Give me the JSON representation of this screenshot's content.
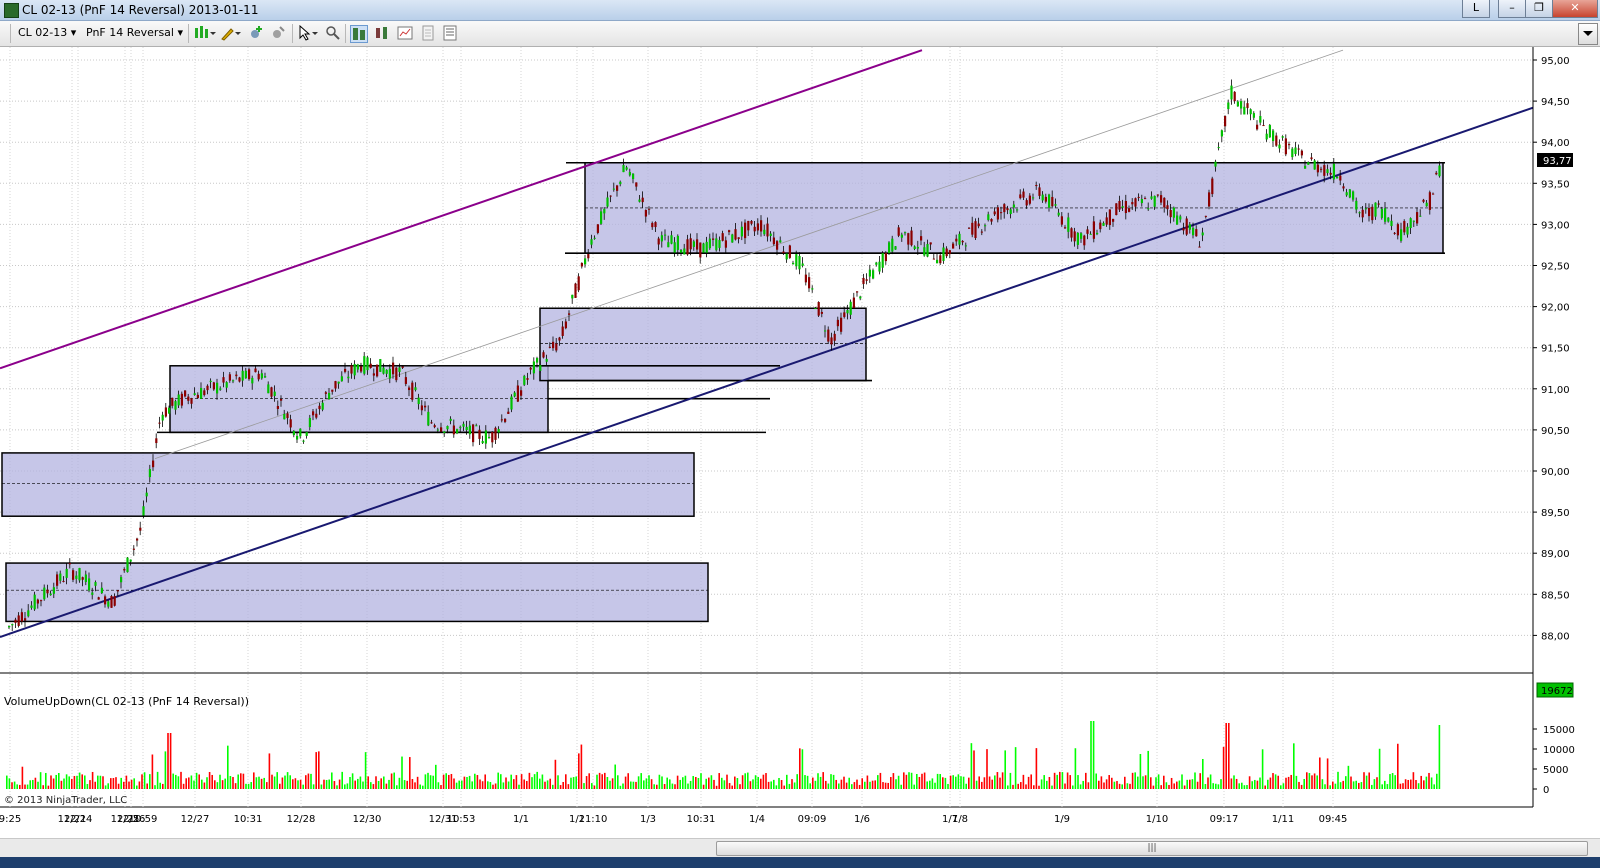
{
  "window": {
    "title": "CL 02-13 (PnF 14 Reversal)  2013-01-11",
    "link_button": "L"
  },
  "toolbar": {
    "instrument": "CL 02-13",
    "period": "PnF 14 Reversal"
  },
  "indicator": {
    "label": "VolumeUpDown(CL 02-13 (PnF 14 Reversal))"
  },
  "copyright": "© 2013 NinjaTrader, LLC",
  "price_axis": {
    "ticks": [
      "95,00",
      "94,50",
      "94,00",
      "93,50",
      "93,00",
      "92,50",
      "92,00",
      "91,50",
      "91,00",
      "90,50",
      "90,00",
      "89,50",
      "89,00",
      "88,50",
      "88,00"
    ],
    "current_price": "93,77"
  },
  "volume_axis": {
    "ticks": [
      "15000",
      "10000",
      "5000",
      "0"
    ],
    "current_volume": "19672"
  },
  "time_axis": {
    "labels": [
      "9:25",
      "12/21",
      "12/24",
      "12/25",
      "12/26",
      "10:59",
      "12/27",
      "10:31",
      "12/28",
      "12/30",
      "12/31",
      "10:53",
      "1/1",
      "1/2",
      "11:10",
      "1/3",
      "10:31",
      "1/4",
      "09:09",
      "1/6",
      "1/7",
      "1/8",
      "1/9",
      "1/10",
      "09:17",
      "1/11",
      "09:45"
    ]
  },
  "colors": {
    "up_bar": "#00c000",
    "down_bar": "#8b0000",
    "box_fill": "#b3b3e0",
    "upper_channel": "#8b008b",
    "trend_line": "#191970",
    "volume_up": "#00ff00",
    "volume_down": "#ff0000"
  },
  "chart_data": {
    "type": "bar",
    "price_series": {
      "name": "",
      "x_labels": [
        "9:25",
        "12/24",
        "12/26",
        "10:59",
        "12/27",
        "10:31",
        "12/28",
        "12/31",
        "10:53",
        "1/2",
        "11:10",
        "1/3",
        "10:31",
        "1/4",
        "09:09",
        "1/7",
        "1/8",
        "1/9",
        "1/10",
        "09:17",
        "1/11",
        "09:45"
      ],
      "values": [
        88.0,
        88.7,
        89.8,
        90.9,
        90.8,
        90.6,
        91.3,
        90.3,
        91.4,
        93.8,
        92.8,
        92.7,
        93.0,
        91.6,
        92.6,
        92.9,
        93.6,
        93.0,
        94.6,
        94.2,
        93.1,
        93.77
      ]
    },
    "volume_series": {
      "name": "",
      "max": 19672
    },
    "ylim": [
      87.7,
      95.1
    ],
    "volume_ylim": [
      0,
      17000
    ],
    "grid": true
  }
}
